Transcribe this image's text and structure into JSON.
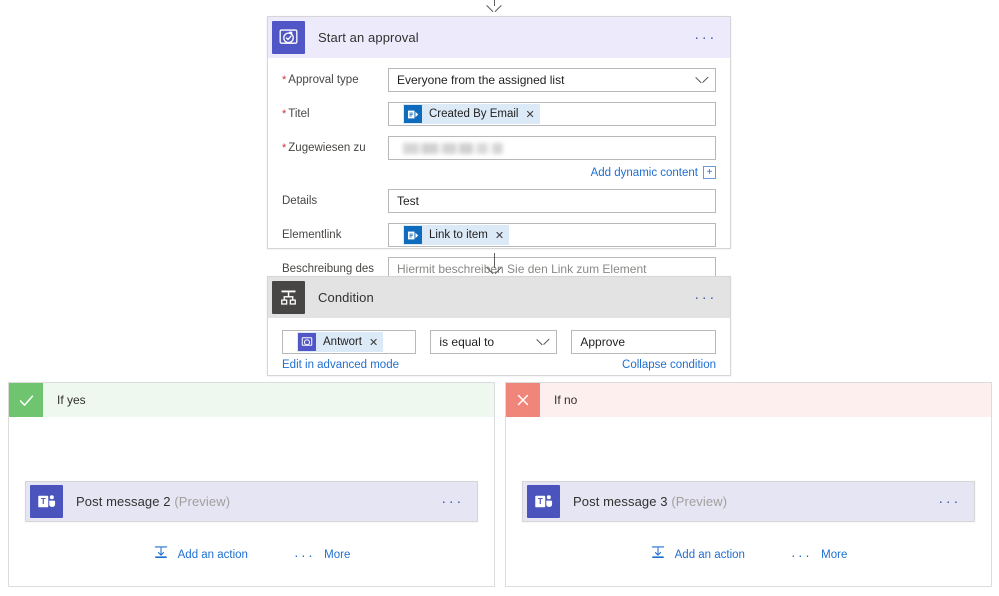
{
  "approval": {
    "title": "Start an approval",
    "icon": "approval-icon",
    "menu": "···",
    "fields": [
      {
        "label": "Approval type",
        "required": true,
        "value": "Everyone from the assigned list",
        "kind": "dropdown"
      },
      {
        "label": "Titel",
        "required": true,
        "token": "Created By Email",
        "token_icon": "sharepoint-icon",
        "kind": "token"
      },
      {
        "label": "Zugewiesen zu",
        "required": true,
        "value": "",
        "kind": "redacted"
      },
      {
        "label": "Details",
        "required": false,
        "value": "Test",
        "kind": "text"
      },
      {
        "label": "Elementlink",
        "required": false,
        "token": "Link to item",
        "token_icon": "sharepoint-icon",
        "kind": "token"
      },
      {
        "label": "Beschreibung des Elementlinks",
        "required": false,
        "value": "Hiermit beschreiben Sie den Link zum Element",
        "kind": "placeholder"
      }
    ],
    "dynamic_content_label": "Add dynamic content",
    "dynamic_content_glyph": "+"
  },
  "condition": {
    "title": "Condition",
    "icon": "condition-icon",
    "menu": "···",
    "left_token": "Antwort",
    "left_token_icon": "approval-icon",
    "operator": "is equal to",
    "value": "Approve",
    "advanced_link": "Edit in advanced mode",
    "collapse_link": "Collapse condition"
  },
  "branches": [
    {
      "label": "If yes",
      "badge_icon": "check-icon",
      "node": {
        "title": "Post message 2",
        "suffix": "(Preview)",
        "icon": "teams-icon",
        "menu": "···"
      },
      "footer": {
        "add_action": "Add an action",
        "add_action_icon": "add-action-icon",
        "more": "More",
        "more_icon": "ellipsis-icon"
      }
    },
    {
      "label": "If no",
      "badge_icon": "close-icon",
      "node": {
        "title": "Post message 3",
        "suffix": "(Preview)",
        "icon": "teams-icon",
        "menu": "···"
      },
      "footer": {
        "add_action": "Add an action",
        "add_action_icon": "add-action-icon",
        "more": "More",
        "more_icon": "ellipsis-icon"
      }
    }
  ],
  "colors": {
    "approval_accent": "#5156c7",
    "condition_accent": "#484644",
    "teams_accent": "#4b53bc",
    "yes_accent": "#6fc46f",
    "no_accent": "#f08579",
    "link": "#1f6fd0",
    "required": "#c4333c"
  }
}
